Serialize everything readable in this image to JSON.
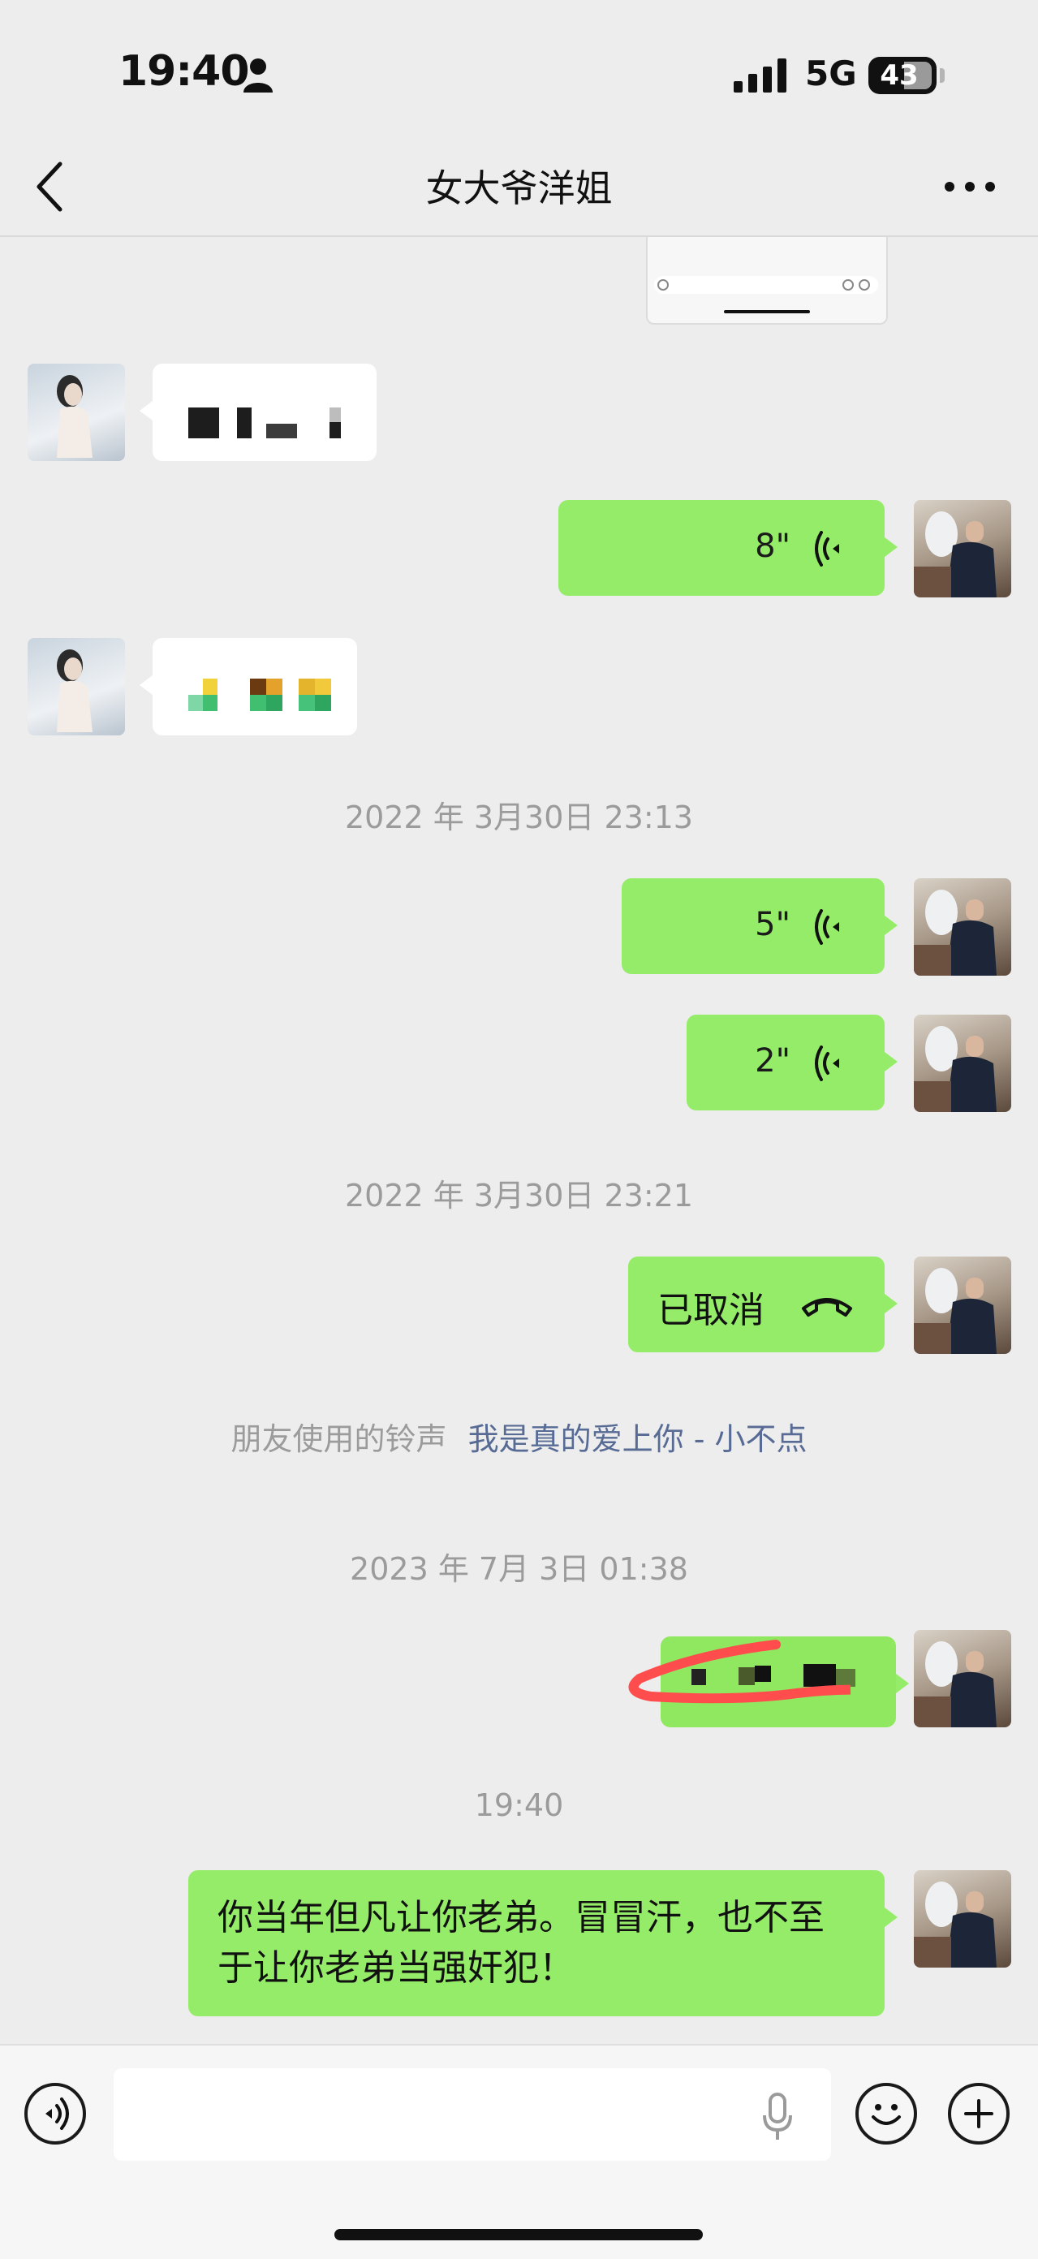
{
  "status_bar": {
    "time": "19:40",
    "network": "5G",
    "battery": "43",
    "icons": [
      "person-icon",
      "signal-bars-icon"
    ]
  },
  "nav": {
    "title": "女大爷洋姐",
    "back_icon": "chevron-left-icon",
    "more_icon": "ellipsis-icon"
  },
  "messages": {
    "voice_1": {
      "duration": "8\""
    },
    "timestamp_1": "2022 年 3月30日 23:13",
    "voice_2": {
      "duration": "5\""
    },
    "voice_3": {
      "duration": "2\""
    },
    "timestamp_2": "2022 年 3月30日 23:21",
    "call": {
      "label": "已取消",
      "icon": "hangup-phone-icon"
    },
    "ringtone": {
      "prefix": "朋友使用的铃声",
      "song": "我是真的爱上你 - 小不点"
    },
    "timestamp_3": "2023 年 7月 3日 01:38",
    "timestamp_4": "19:40",
    "last_text": "你当年但凡让你老弟。冒冒汗，也不至于让你老弟当强奸犯！"
  },
  "input_bar": {
    "voice_toggle_icon": "voice-wave-icon",
    "mic_icon": "microphone-icon",
    "emoji_icon": "smiley-icon",
    "plus_icon": "plus-icon"
  },
  "colors": {
    "background": "#ededed",
    "outgoing_bubble": "#95ec69",
    "incoming_bubble": "#ffffff",
    "link": "#576b95",
    "timestamp": "#9b9b9b",
    "annotation_scribble": "#ff4d4d"
  }
}
